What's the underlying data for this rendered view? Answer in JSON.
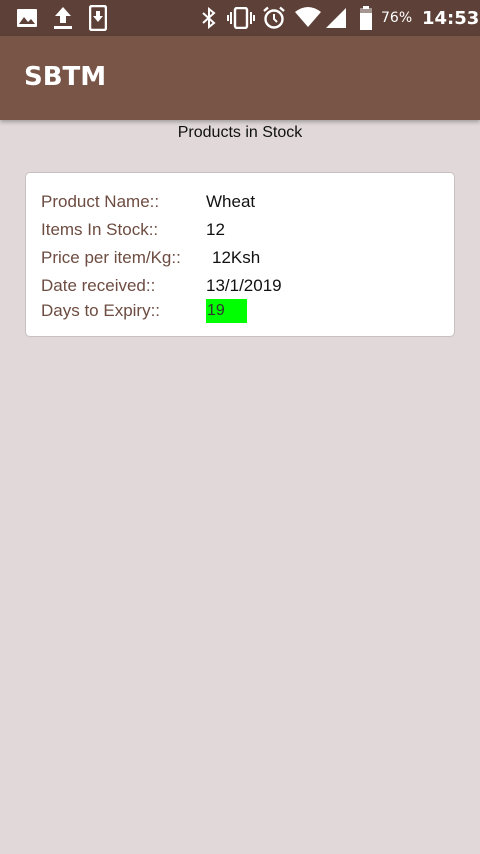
{
  "status_bar": {
    "icons": [
      "image-icon",
      "upload-icon",
      "download-icon",
      "bluetooth-icon",
      "vibrate-icon",
      "alarm-icon",
      "wifi-icon",
      "signal-icon",
      "battery-icon"
    ],
    "battery": "76%",
    "time": "14:53"
  },
  "app_bar": {
    "title": "SBTM",
    "color": "#795548"
  },
  "page": {
    "heading": "Products in Stock"
  },
  "product": {
    "name_label": "Product Name::",
    "name": "Wheat",
    "stock_label": "Items In Stock::",
    "stock": "12",
    "price_label": "Price per item/Kg::",
    "price": "12Ksh",
    "date_label": "Date received::",
    "date": "13/1/2019",
    "expiry_label": "Days to Expiry::",
    "expiry": "19",
    "expiry_color": "#00ff00"
  }
}
